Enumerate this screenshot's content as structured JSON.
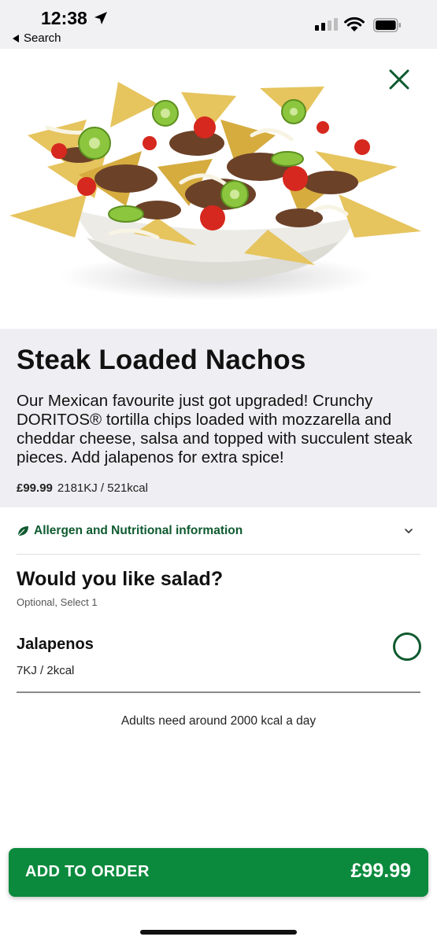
{
  "status_bar": {
    "time": "12:38",
    "back_label": "Search",
    "icons": [
      "location-arrow-icon",
      "cell-signal-icon",
      "wifi-icon",
      "battery-icon"
    ]
  },
  "hero": {
    "image_desc": "nachos-bowl-photo",
    "close_icon": "close-icon"
  },
  "product": {
    "title": "Steak Loaded Nachos",
    "description": "Our Mexican favourite just got upgraded! Crunchy DORITOS® tortilla chips loaded with mozzarella and cheddar cheese, salsa and topped with succulent steak pieces. Add jalapenos for extra spice!",
    "price": "£99.99",
    "energy": "2181KJ / 521kcal"
  },
  "allergen": {
    "label": "Allergen and Nutritional information",
    "icons": [
      "leaf-icon",
      "chevron-down-icon"
    ]
  },
  "options_group": {
    "question": "Would you like salad?",
    "subtitle": "Optional, Select 1",
    "options": [
      {
        "name": "Jalapenos",
        "energy": "7KJ / 2kcal",
        "selected": false
      }
    ]
  },
  "footnote": "Adults need around 2000 kcal a day",
  "add_button": {
    "label": "ADD TO ORDER",
    "price": "£99.99"
  },
  "colors": {
    "brand_green": "#0b8a3d",
    "dark_green": "#0e5a2f",
    "panel_gray": "#efeff3"
  }
}
